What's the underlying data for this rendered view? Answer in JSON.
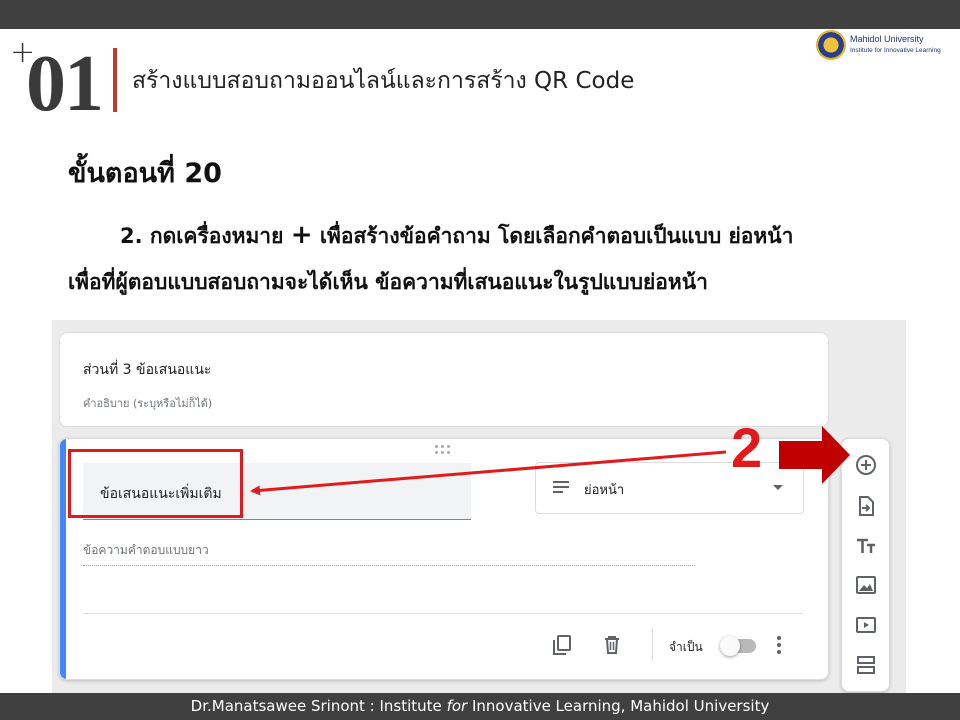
{
  "slide": {
    "plus": "+",
    "number": "01",
    "title": "สร้างแบบสอบถามออนไลน์และการสร้าง  QR Code",
    "step_heading": "ขั้นตอนที่ 20",
    "instruction_line1_a": "2. กดเครื่องหมาย ",
    "instruction_plus": "+",
    "instruction_line1_b": " เพื่อสร้างข้อคำถาม โดยเลือกคำตอบเป็นแบบ  ย่อหน้า",
    "instruction_line2": "เพื่อที่ผู้ตอบแบบสอบถามจะได้เห็น  ข้อความที่เสนอแนะในรูปแบบย่อหน้า",
    "annotation_number": "2",
    "accent_color": "#c0392b",
    "annotation_color": "#e11b1b"
  },
  "logo": {
    "line1": "Mahidol  University",
    "line2": "Institute for Innovative Learning"
  },
  "form": {
    "section_title": "ส่วนที่ 3 ข้อเสนอแนะ",
    "section_description": "คำอธิบาย (ระบุหรือไม่ก็ได้)",
    "question_title": "ข้อเสนอแนะเพิ่มเติม",
    "question_type": "ย่อหน้า",
    "answer_placeholder": "ข้อความคำตอบแบบยาว",
    "required_label": "จำเป็น",
    "card_accent_color": "#4285f4"
  },
  "toolbar": {
    "items": [
      "add-question",
      "import-questions",
      "add-title-description",
      "add-image",
      "add-video",
      "add-section"
    ]
  },
  "footer": {
    "prefix": "Dr.Manatsawee  Srinont : Institute ",
    "italic": "for",
    "suffix": " Innovative Learning, Mahidol University"
  }
}
